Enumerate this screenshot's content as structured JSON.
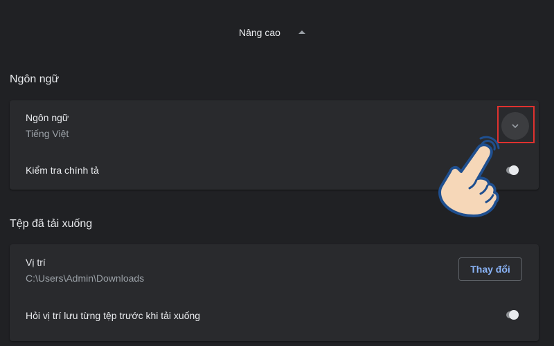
{
  "advanced": {
    "label": "Nâng cao",
    "expanded": true
  },
  "sections": {
    "language": {
      "title": "Ngôn ngữ",
      "rows": {
        "language": {
          "title": "Ngôn ngữ",
          "value": "Tiếng Việt"
        },
        "spellcheck": {
          "title": "Kiểm tra chính tả",
          "enabled": false
        }
      }
    },
    "downloads": {
      "title": "Tệp đã tải xuống",
      "rows": {
        "location": {
          "title": "Vị trí",
          "value": "C:\\Users\\Admin\\Downloads",
          "change_label": "Thay đổi"
        },
        "ask_location": {
          "title": "Hỏi vị trí lưu từng tệp trước khi tải xuống",
          "enabled": false
        }
      }
    }
  },
  "icons": {
    "expand": "chevron-down-icon",
    "collapse": "arrow-up-icon",
    "pointer": "pointing-hand-icon"
  },
  "colors": {
    "background": "#202124",
    "card": "#292a2d",
    "text": "#e8eaed",
    "secondary_text": "#9aa0a6",
    "link": "#8ab4f8",
    "highlight": "#e0312f"
  }
}
